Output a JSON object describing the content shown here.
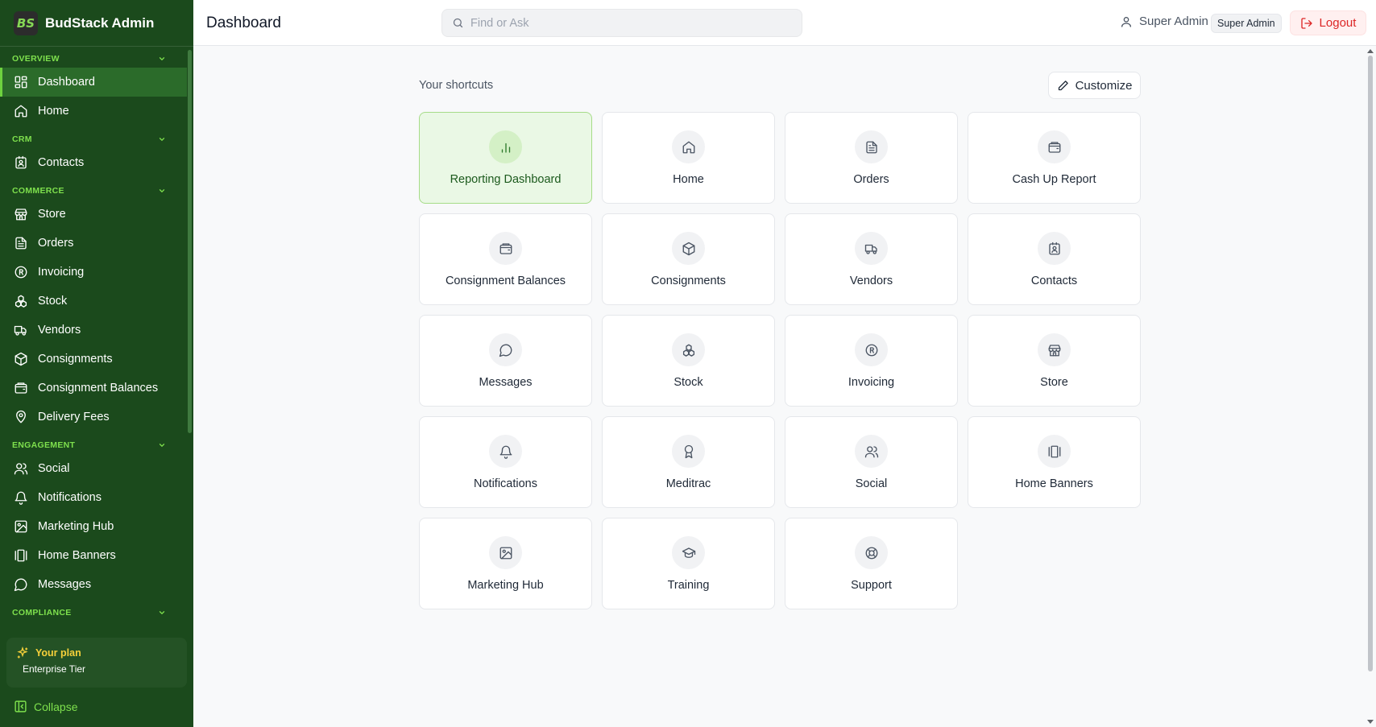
{
  "app": {
    "brand_logo_text": "BS",
    "brand_name": "BudStack Admin"
  },
  "sidebar": {
    "sections": [
      {
        "title": "OVERVIEW",
        "items": [
          {
            "label": "Dashboard",
            "icon": "dashboard-icon",
            "active": true
          },
          {
            "label": "Home",
            "icon": "home-icon"
          }
        ]
      },
      {
        "title": "CRM",
        "items": [
          {
            "label": "Contacts",
            "icon": "contacts-icon"
          }
        ]
      },
      {
        "title": "COMMERCE",
        "items": [
          {
            "label": "Store",
            "icon": "store-icon"
          },
          {
            "label": "Orders",
            "icon": "orders-icon"
          },
          {
            "label": "Invoicing",
            "icon": "invoicing-icon"
          },
          {
            "label": "Stock",
            "icon": "stock-icon"
          },
          {
            "label": "Vendors",
            "icon": "vendors-icon"
          },
          {
            "label": "Consignments",
            "icon": "consignments-icon"
          },
          {
            "label": "Consignment Balances",
            "icon": "consignment-balances-icon"
          },
          {
            "label": "Delivery Fees",
            "icon": "delivery-fees-icon"
          }
        ]
      },
      {
        "title": "ENGAGEMENT",
        "items": [
          {
            "label": "Social",
            "icon": "social-icon"
          },
          {
            "label": "Notifications",
            "icon": "notifications-icon"
          },
          {
            "label": "Marketing Hub",
            "icon": "marketing-hub-icon"
          },
          {
            "label": "Home Banners",
            "icon": "home-banners-icon"
          },
          {
            "label": "Messages",
            "icon": "messages-icon"
          }
        ]
      },
      {
        "title": "COMPLIANCE",
        "items": []
      }
    ],
    "plan": {
      "title": "Your plan",
      "tier": "Enterprise Tier",
      "icon": "sparkle-icon"
    },
    "collapse_label": "Collapse"
  },
  "header": {
    "title": "Dashboard",
    "search_placeholder": "Find or Ask",
    "user_name": "Super Admin",
    "role_badge": "Super Admin",
    "logout_label": "Logout"
  },
  "main": {
    "shortcuts_label": "Your shortcuts",
    "customize_label": "Customize",
    "shortcuts": [
      {
        "label": "Reporting Dashboard",
        "icon": "bar-chart-icon",
        "active": true
      },
      {
        "label": "Home",
        "icon": "home-icon"
      },
      {
        "label": "Orders",
        "icon": "orders-icon"
      },
      {
        "label": "Cash Up Report",
        "icon": "wallet-icon"
      },
      {
        "label": "Consignment Balances",
        "icon": "wallet-icon"
      },
      {
        "label": "Consignments",
        "icon": "package-icon"
      },
      {
        "label": "Vendors",
        "icon": "truck-icon"
      },
      {
        "label": "Contacts",
        "icon": "contacts-icon"
      },
      {
        "label": "Messages",
        "icon": "message-icon"
      },
      {
        "label": "Stock",
        "icon": "boxes-icon"
      },
      {
        "label": "Invoicing",
        "icon": "registered-icon"
      },
      {
        "label": "Store",
        "icon": "store-icon"
      },
      {
        "label": "Notifications",
        "icon": "bell-icon"
      },
      {
        "label": "Meditrac",
        "icon": "award-icon"
      },
      {
        "label": "Social",
        "icon": "users-icon"
      },
      {
        "label": "Home Banners",
        "icon": "gallery-icon"
      },
      {
        "label": "Marketing Hub",
        "icon": "image-icon"
      },
      {
        "label": "Training",
        "icon": "graduation-cap-icon"
      },
      {
        "label": "Support",
        "icon": "life-buoy-icon"
      }
    ]
  },
  "colors": {
    "sidebar_bg": "#1b4a1c",
    "sidebar_accent": "#7ee04d",
    "active_tile_bg": "#eaf8e5",
    "logout": "#dc2626",
    "plan_title": "#f6d03a"
  }
}
